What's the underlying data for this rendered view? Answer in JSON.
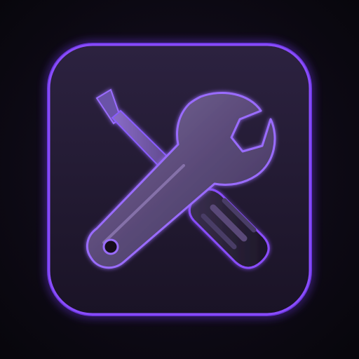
{
  "icon": {
    "name": "settings-tools-app-icon",
    "symbol": "wrench-and-screwdriver",
    "depicts": [
      "wrench-icon",
      "screwdriver-icon"
    ]
  },
  "colors": {
    "background": "#0a0810",
    "tile_fill": "#231a30",
    "tile_glow": "#7a3cff",
    "wrench_fill": "#5a4a78",
    "screwdriver_handle": "#2a2238",
    "accent_purple": "#8a4dff"
  }
}
